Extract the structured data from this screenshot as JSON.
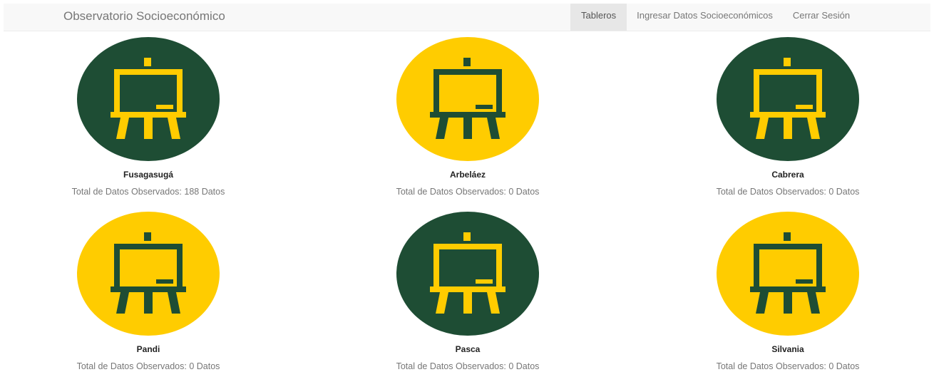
{
  "navbar": {
    "brand": "Observatorio Socioeconómico",
    "items": [
      {
        "label": "Tableros",
        "active": true
      },
      {
        "label": "Ingresar Datos Socioeconómicos",
        "active": false
      },
      {
        "label": "Cerrar Sesión",
        "active": false
      }
    ]
  },
  "colors": {
    "green": "#1e4d34",
    "yellow": "#ffcc00"
  },
  "boards": [
    {
      "name": "Fusagasugá",
      "count_text": "Total de Datos Observados: 188 Datos",
      "circle_color": "green",
      "icon": "easel-board-icon"
    },
    {
      "name": "Arbeláez",
      "count_text": "Total de Datos Observados: 0 Datos",
      "circle_color": "yellow",
      "icon": "easel-board-icon"
    },
    {
      "name": "Cabrera",
      "count_text": "Total de Datos Observados: 0 Datos",
      "circle_color": "green",
      "icon": "easel-board-icon"
    },
    {
      "name": "Pandi",
      "count_text": "Total de Datos Observados: 0 Datos",
      "circle_color": "yellow",
      "icon": "easel-board-icon"
    },
    {
      "name": "Pasca",
      "count_text": "Total de Datos Observados: 0 Datos",
      "circle_color": "green",
      "icon": "easel-board-icon"
    },
    {
      "name": "Silvania",
      "count_text": "Total de Datos Observados: 0 Datos",
      "circle_color": "yellow",
      "icon": "easel-board-icon"
    }
  ]
}
